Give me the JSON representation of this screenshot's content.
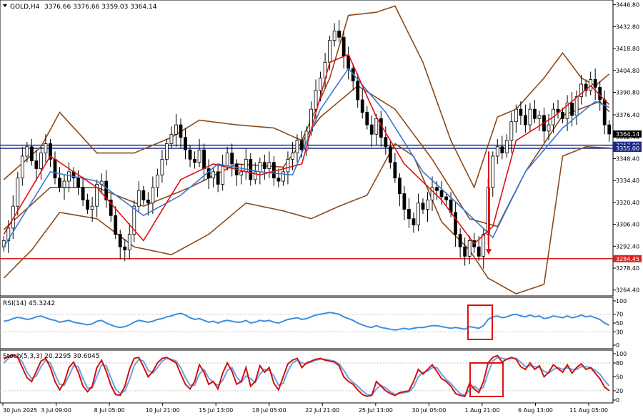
{
  "header": {
    "symbol": "GOLD,H4",
    "ohlc": "3376.66 3376.66 3359.03 3364.14"
  },
  "indicators": {
    "rsi_label": "RSI(14) 45.3242",
    "stoch_label": "Stoch(5,3,3) 20.2295 30.6045"
  },
  "colors": {
    "price_axis_badge": "#000000",
    "blue_level_badge": "#1a2a8a",
    "red_level_badge": "#e02020",
    "ema_fast": "#e01010",
    "ema_slow": "#3a78d8",
    "bollinger": "#8b4a1a",
    "rsi_line": "#3a8ee0",
    "stoch_main": "#d01010",
    "stoch_signal": "#6fa0e0",
    "annotation": "#e01010"
  },
  "chart_data": [
    {
      "type": "candlestick",
      "title": "GOLD,H4",
      "ylim": [
        3262,
        3448
      ],
      "y_ticks": [
        "3446.80",
        "3432.80",
        "3418.80",
        "3404.80",
        "3390.80",
        "3376.40",
        "3362.40",
        "3348.40",
        "3334.40",
        "3320.40",
        "3306.40",
        "3292.40",
        "3278.40",
        "3264.40"
      ],
      "x_ticks": [
        "30 Jun 2025",
        "3 Jul 09:00",
        "8 Jul 05:00",
        "10 Jul 21:00",
        "15 Jul 13:00",
        "18 Jul 05:00",
        "22 Jul 21:00",
        "25 Jul 13:00",
        "30 Jul 05:00",
        "1 Aug 21:00",
        "6 Aug 13:00",
        "11 Aug 05:00"
      ],
      "close_series": [
        3296,
        3304,
        3318,
        3336,
        3350,
        3356,
        3347,
        3342,
        3352,
        3358,
        3348,
        3336,
        3330,
        3334,
        3340,
        3336,
        3330,
        3322,
        3316,
        3318,
        3332,
        3334,
        3322,
        3312,
        3300,
        3292,
        3290,
        3300,
        3318,
        3328,
        3322,
        3320,
        3330,
        3338,
        3348,
        3358,
        3364,
        3370,
        3362,
        3354,
        3348,
        3346,
        3354,
        3342,
        3336,
        3340,
        3332,
        3344,
        3352,
        3345,
        3338,
        3340,
        3348,
        3335,
        3340,
        3346,
        3342,
        3346,
        3336,
        3334,
        3340,
        3348,
        3352,
        3360,
        3354,
        3366,
        3380,
        3392,
        3400,
        3410,
        3424,
        3430,
        3426,
        3414,
        3406,
        3398,
        3386,
        3378,
        3370,
        3364,
        3374,
        3362,
        3356,
        3346,
        3336,
        3326,
        3316,
        3310,
        3306,
        3320,
        3316,
        3322,
        3330,
        3328,
        3324,
        3322,
        3314,
        3300,
        3292,
        3286,
        3296,
        3292,
        3286,
        3300,
        3330,
        3350,
        3356,
        3352,
        3360,
        3372,
        3380,
        3376,
        3370,
        3380,
        3374,
        3376,
        3366,
        3370,
        3380,
        3378,
        3374,
        3384,
        3376,
        3388,
        3396,
        3392,
        3399,
        3394,
        3386,
        3370,
        3364.14
      ],
      "ema_fast_anchors": [
        [
          0,
          3300
        ],
        [
          10,
          3350
        ],
        [
          20,
          3330
        ],
        [
          30,
          3296
        ],
        [
          38,
          3335
        ],
        [
          45,
          3345
        ],
        [
          55,
          3338
        ],
        [
          64,
          3345
        ],
        [
          70,
          3410
        ],
        [
          74,
          3415
        ],
        [
          80,
          3375
        ],
        [
          86,
          3345
        ],
        [
          94,
          3322
        ],
        [
          101,
          3294
        ],
        [
          105,
          3305
        ],
        [
          110,
          3360
        ],
        [
          118,
          3375
        ],
        [
          126,
          3395
        ],
        [
          131,
          3380
        ]
      ],
      "ema_slow_anchors": [
        [
          0,
          3292
        ],
        [
          10,
          3340
        ],
        [
          20,
          3334
        ],
        [
          30,
          3312
        ],
        [
          38,
          3325
        ],
        [
          46,
          3345
        ],
        [
          55,
          3340
        ],
        [
          62,
          3338
        ],
        [
          68,
          3380
        ],
        [
          74,
          3406
        ],
        [
          82,
          3378
        ],
        [
          90,
          3340
        ],
        [
          98,
          3318
        ],
        [
          105,
          3298
        ],
        [
          112,
          3340
        ],
        [
          120,
          3368
        ],
        [
          127,
          3385
        ],
        [
          131,
          3380
        ]
      ],
      "bollinger_upper_anchors": [
        [
          0,
          3335
        ],
        [
          8,
          3356
        ],
        [
          12,
          3378
        ],
        [
          20,
          3352
        ],
        [
          28,
          3352
        ],
        [
          36,
          3362
        ],
        [
          42,
          3373
        ],
        [
          50,
          3370
        ],
        [
          58,
          3368
        ],
        [
          64,
          3360
        ],
        [
          70,
          3400
        ],
        [
          74,
          3440
        ],
        [
          80,
          3442
        ],
        [
          84,
          3446
        ],
        [
          90,
          3410
        ],
        [
          96,
          3360
        ],
        [
          101,
          3330
        ],
        [
          106,
          3375
        ],
        [
          110,
          3380
        ],
        [
          116,
          3400
        ],
        [
          120,
          3416
        ],
        [
          124,
          3400
        ],
        [
          127,
          3395
        ],
        [
          131,
          3405
        ]
      ],
      "bollinger_lower_anchors": [
        [
          0,
          3272
        ],
        [
          6,
          3290
        ],
        [
          12,
          3314
        ],
        [
          20,
          3310
        ],
        [
          28,
          3292
        ],
        [
          36,
          3287
        ],
        [
          44,
          3300
        ],
        [
          52,
          3320
        ],
        [
          60,
          3315
        ],
        [
          66,
          3310
        ],
        [
          72,
          3318
        ],
        [
          78,
          3325
        ],
        [
          84,
          3358
        ],
        [
          88,
          3350
        ],
        [
          94,
          3308
        ],
        [
          100,
          3290
        ],
        [
          104,
          3272
        ],
        [
          110,
          3262
        ],
        [
          116,
          3268
        ],
        [
          120,
          3350
        ],
        [
          125,
          3356
        ],
        [
          131,
          3355
        ]
      ],
      "bollinger_mid_anchors": [
        [
          0,
          3303
        ],
        [
          10,
          3330
        ],
        [
          20,
          3330
        ],
        [
          30,
          3318
        ],
        [
          40,
          3330
        ],
        [
          50,
          3345
        ],
        [
          60,
          3343
        ],
        [
          68,
          3375
        ],
        [
          76,
          3395
        ],
        [
          84,
          3380
        ],
        [
          92,
          3348
        ],
        [
          100,
          3310
        ],
        [
          106,
          3305
        ],
        [
          112,
          3340
        ],
        [
          120,
          3376
        ],
        [
          128,
          3385
        ],
        [
          131,
          3375
        ]
      ],
      "levels": [
        {
          "name": "resistance-blue",
          "value": 3357.0,
          "label": "3357.00",
          "color": "#1a2a8a"
        },
        {
          "name": "support-dark",
          "value": 3355.0,
          "label": "3355.00",
          "color": "#1a2a8a"
        },
        {
          "name": "target-red",
          "value": 3284.45,
          "label": "3284.45",
          "color": "#e02020"
        }
      ],
      "current_price": "3364.14",
      "arrow": {
        "from": 3353,
        "to": 3287
      }
    },
    {
      "type": "line",
      "title": "RSI(14) 45.3242",
      "ylim": [
        0,
        100
      ],
      "y_ticks": [
        "100",
        "70",
        "50",
        "30",
        "0"
      ],
      "series": [
        {
          "values": [
            54,
            56,
            60,
            63,
            61,
            58,
            60,
            64,
            66,
            62,
            58,
            56,
            52,
            54,
            56,
            52,
            50,
            48,
            46,
            48,
            54,
            56,
            50,
            46,
            42,
            40,
            42,
            46,
            52,
            56,
            54,
            52,
            54,
            58,
            60,
            64,
            66,
            70,
            72,
            68,
            62,
            58,
            60,
            56,
            52,
            54,
            50,
            54,
            56,
            54,
            52,
            52,
            56,
            50,
            52,
            56,
            54,
            56,
            52,
            50,
            54,
            58,
            60,
            62,
            58,
            60,
            64,
            68,
            70,
            72,
            74,
            72,
            70,
            64,
            60,
            56,
            50,
            46,
            42,
            40,
            44,
            40,
            38,
            36,
            34,
            36,
            38,
            36,
            38,
            40,
            40,
            42,
            44,
            44,
            42,
            40,
            38,
            40,
            38,
            36,
            42,
            40,
            38,
            44,
            58,
            64,
            66,
            62,
            64,
            68,
            70,
            66,
            64,
            68,
            64,
            66,
            60,
            62,
            66,
            64,
            62,
            66,
            62,
            64,
            68,
            64,
            66,
            62,
            58,
            50,
            45.3242
          ]
        }
      ],
      "annotation_box": true
    },
    {
      "type": "line",
      "title": "Stoch(5,3,3) 20.2295 30.6045",
      "ylim": [
        0,
        100
      ],
      "y_ticks": [
        "100",
        "80",
        "50",
        "20",
        "0"
      ],
      "series": [
        {
          "values": [
            88,
            94,
            98,
            92,
            70,
            48,
            40,
            62,
            84,
            90,
            70,
            40,
            22,
            38,
            70,
            82,
            60,
            30,
            18,
            30,
            70,
            86,
            62,
            32,
            12,
            10,
            30,
            66,
            90,
            92,
            72,
            50,
            62,
            80,
            90,
            92,
            86,
            80,
            56,
            34,
            24,
            40,
            76,
            60,
            34,
            40,
            24,
            58,
            80,
            62,
            34,
            40,
            70,
            30,
            40,
            74,
            60,
            70,
            36,
            22,
            50,
            78,
            86,
            90,
            70,
            80,
            84,
            88,
            90,
            86,
            84,
            82,
            74,
            50,
            40,
            34,
            22,
            12,
            8,
            10,
            40,
            30,
            20,
            14,
            10,
            16,
            18,
            20,
            40,
            66,
            56,
            66,
            76,
            62,
            46,
            40,
            30,
            14,
            10,
            8,
            36,
            24,
            16,
            40,
            80,
            92,
            96,
            82,
            88,
            92,
            88,
            72,
            66,
            80,
            66,
            74,
            50,
            60,
            76,
            68,
            60,
            76,
            58,
            70,
            78,
            66,
            70,
            58,
            46,
            28,
            20.2295
          ]
        },
        {
          "values": [
            80,
            90,
            96,
            94,
            82,
            60,
            46,
            52,
            72,
            86,
            80,
            56,
            34,
            32,
            52,
            74,
            72,
            46,
            26,
            26,
            50,
            76,
            74,
            48,
            24,
            14,
            20,
            44,
            74,
            88,
            84,
            64,
            58,
            70,
            84,
            90,
            88,
            84,
            70,
            48,
            32,
            32,
            56,
            66,
            48,
            38,
            32,
            42,
            64,
            70,
            50,
            38,
            52,
            46,
            38,
            56,
            66,
            64,
            52,
            32,
            36,
            62,
            80,
            86,
            80,
            78,
            82,
            86,
            88,
            88,
            86,
            84,
            78,
            64,
            48,
            38,
            30,
            20,
            12,
            10,
            24,
            32,
            26,
            18,
            12,
            14,
            16,
            18,
            28,
            50,
            60,
            62,
            70,
            70,
            56,
            44,
            36,
            24,
            14,
            10,
            22,
            30,
            22,
            28,
            58,
            84,
            92,
            90,
            88,
            90,
            90,
            82,
            72,
            74,
            72,
            70,
            62,
            58,
            66,
            70,
            66,
            70,
            66,
            66,
            72,
            72,
            70,
            64,
            56,
            42,
            30.6045
          ]
        }
      ],
      "annotation_box": true
    }
  ]
}
